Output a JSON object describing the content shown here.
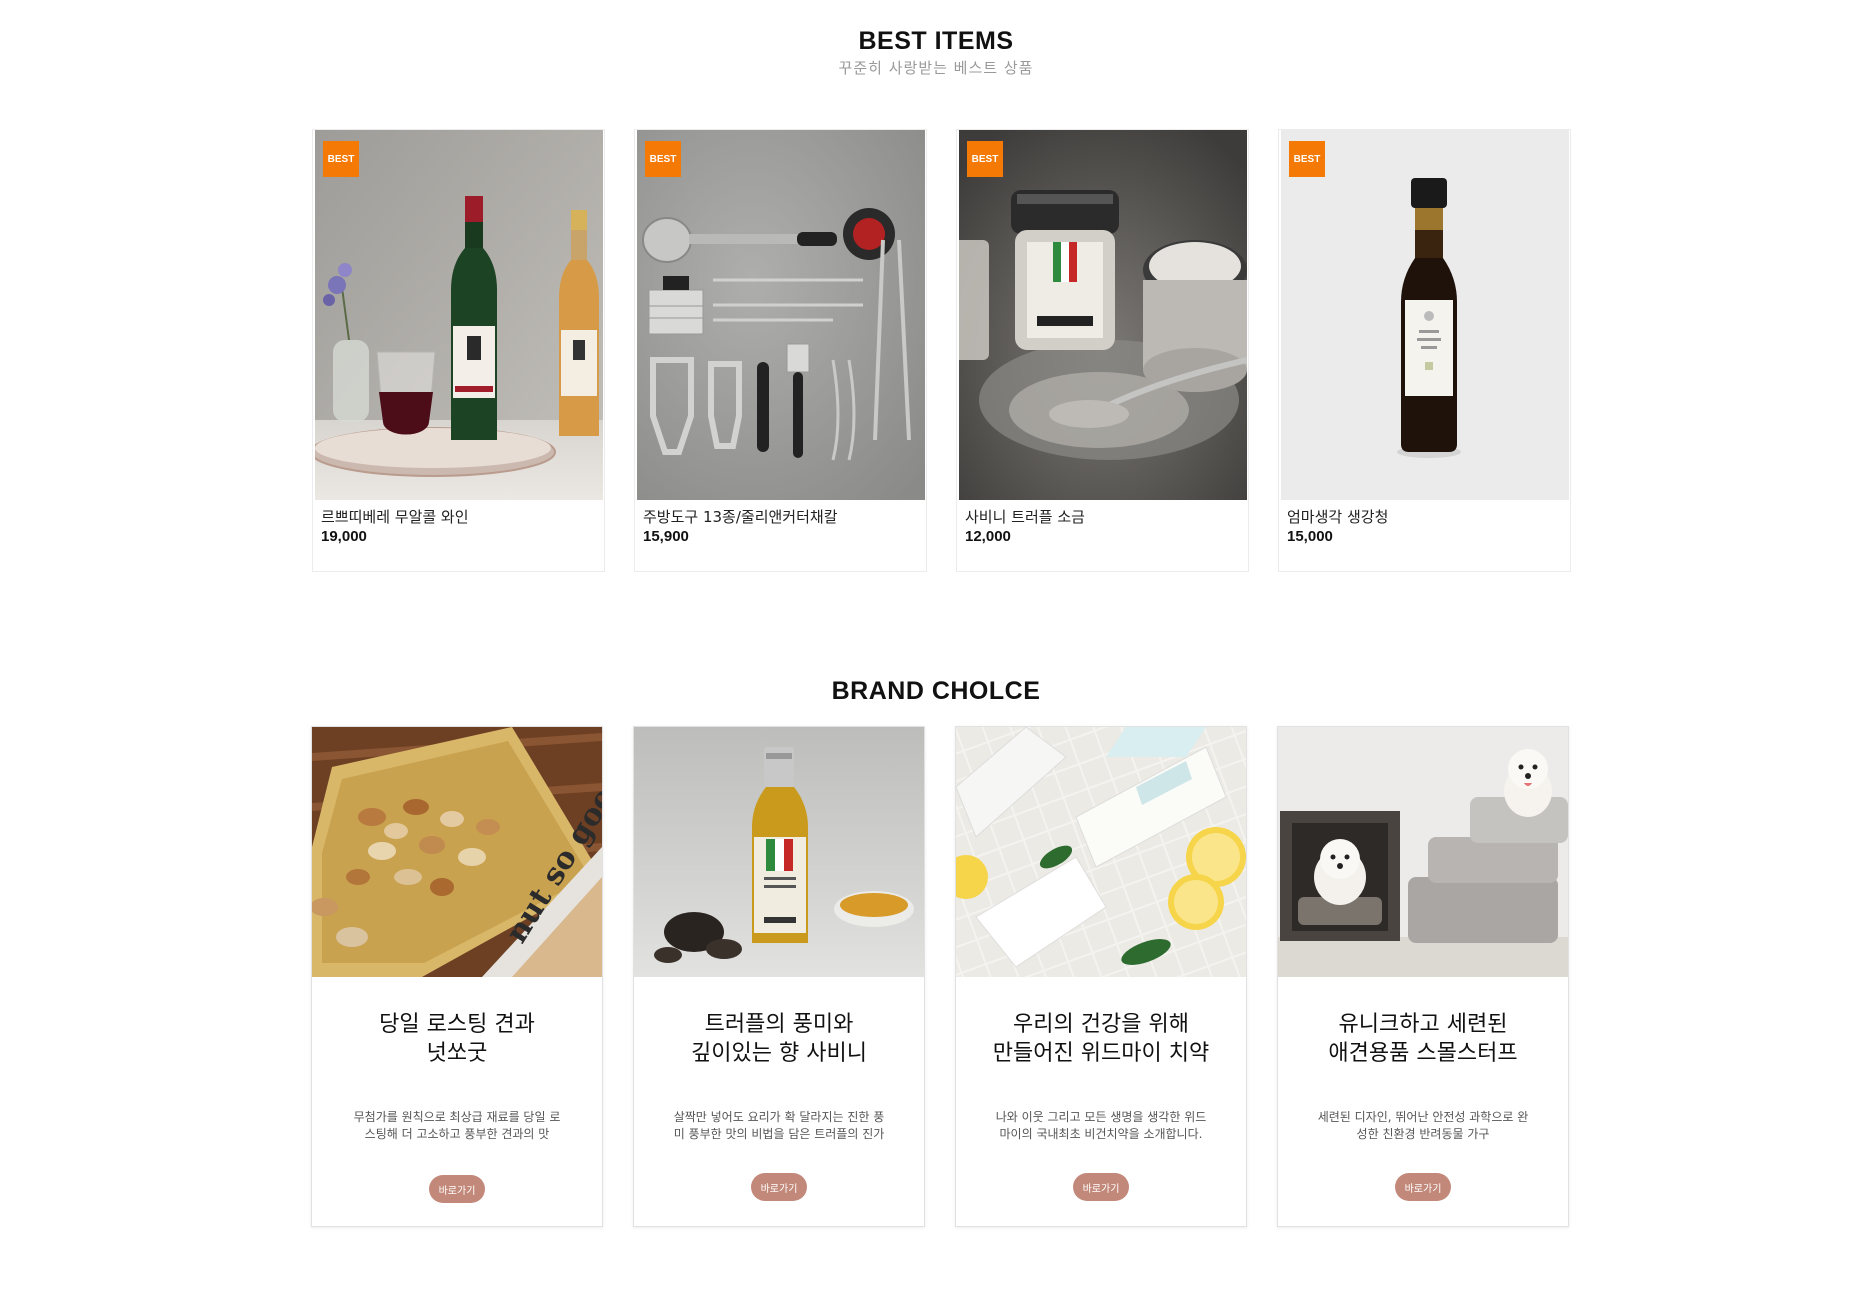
{
  "best_section": {
    "title": "BEST ITEMS",
    "subtitle": "꾸준히 사랑받는 베스트 상품",
    "items": [
      {
        "badge": "BEST",
        "name": "르쁘띠베레 무알콜 와인",
        "price": "19,000",
        "image": "wine-bottles-photo"
      },
      {
        "badge": "BEST",
        "name": "주방도구 13종/줄리앤커터채칼",
        "price": "15,900",
        "image": "kitchen-tools-photo"
      },
      {
        "badge": "BEST",
        "name": "사비니 트러플 소금",
        "price": "12,000",
        "image": "truffle-salt-jar-photo"
      },
      {
        "badge": "BEST",
        "name": "엄마생각 생강청",
        "price": "15,000",
        "image": "ginger-syrup-bottle-photo"
      }
    ]
  },
  "brand_section": {
    "title": "BRAND CHOLCE",
    "cards": [
      {
        "title_line1": "당일 로스팅 견과",
        "title_line2": "넛쏘굿",
        "desc_line1": "무첨가를 원칙으로 최상급 재료를 당일 로",
        "desc_line2": "스팅해 더 고소하고 풍부한 견과의 맛",
        "button": "바로가기",
        "image": "nuts-tray-photo"
      },
      {
        "title_line1": "트러플의 풍미와",
        "title_line2": "깊이있는 향 사비니",
        "desc_line1": "살짝만 넣어도 요리가 확 달라지는 진한 풍",
        "desc_line2": "미 풍부한 맛의 비법을 담은 트러플의 진가",
        "button": "바로가기",
        "image": "truffle-oil-photo"
      },
      {
        "title_line1": "우리의 건강을 위해",
        "title_line2": "만들어진 위드마이 치약",
        "desc_line1": "나와 이웃 그리고 모든 생명을 생각한 위드",
        "desc_line2": "마이의 국내최초 비건치약을 소개합니다.",
        "button": "바로가기",
        "image": "toothpaste-lemon-photo"
      },
      {
        "title_line1": "유니크하고 세련된",
        "title_line2": "애견용품 스몰스터프",
        "desc_line1": "세련된 디자인, 뛰어난 안전성 과학으로 완",
        "desc_line2": "성한 친환경 반려동물 가구",
        "button": "바로가기",
        "image": "pet-furniture-photo"
      }
    ]
  },
  "colors": {
    "badge": "#f57a05",
    "button": "#c2897a",
    "subtitle": "#9a9a9a"
  }
}
